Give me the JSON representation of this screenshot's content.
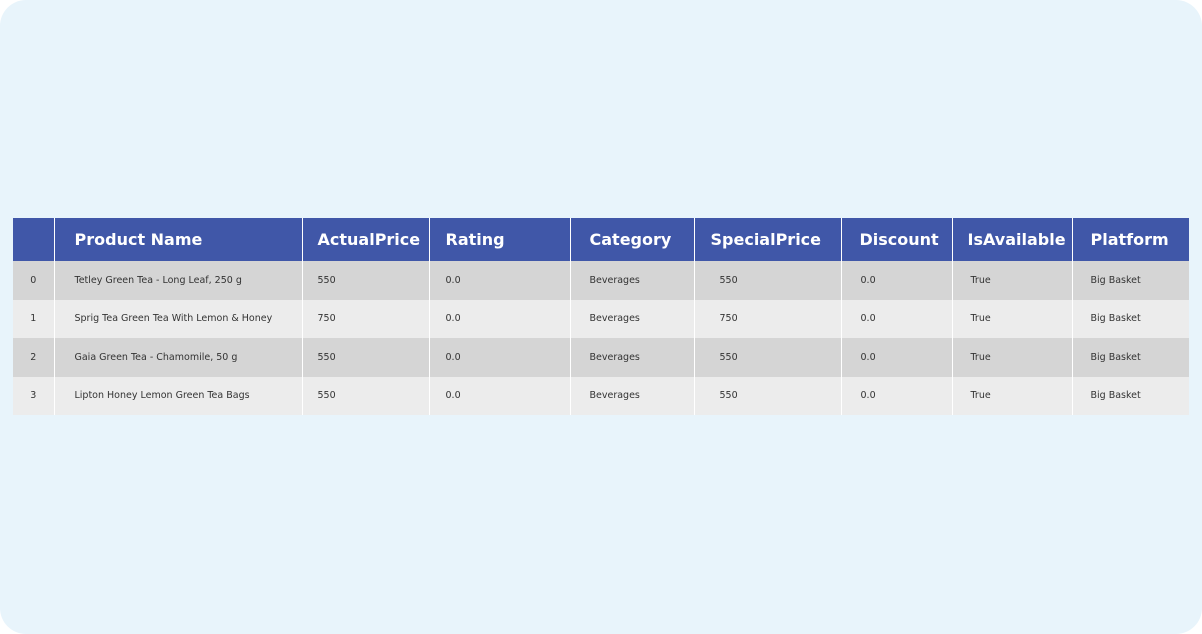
{
  "table": {
    "columns": [
      "",
      "Product Name",
      "ActualPrice",
      "Rating",
      "Category",
      "SpecialPrice",
      "Discount",
      "IsAvailable",
      "Platform"
    ],
    "rows": [
      [
        "0",
        "Tetley Green Tea - Long Leaf, 250 g",
        "550",
        "0.0",
        "Beverages",
        "550",
        "0.0",
        "True",
        "Big Basket"
      ],
      [
        "1",
        "Sprig Tea Green Tea With Lemon & Honey",
        "750",
        "0.0",
        "Beverages",
        "750",
        "0.0",
        "True",
        "Big Basket"
      ],
      [
        "2",
        "Gaia Green Tea - Chamomile, 50 g",
        "550",
        "0.0",
        "Beverages",
        "550",
        "0.0",
        "True",
        "Big Basket"
      ],
      [
        "3",
        "Lipton Honey Lemon Green Tea Bags",
        "550",
        "0.0",
        "Beverages",
        "550",
        "0.0",
        "True",
        "Big Basket"
      ]
    ]
  },
  "colors": {
    "background": "#e8f4fb",
    "header": "#4057a8",
    "row_odd": "#d5d5d5",
    "row_even": "#ececec"
  }
}
